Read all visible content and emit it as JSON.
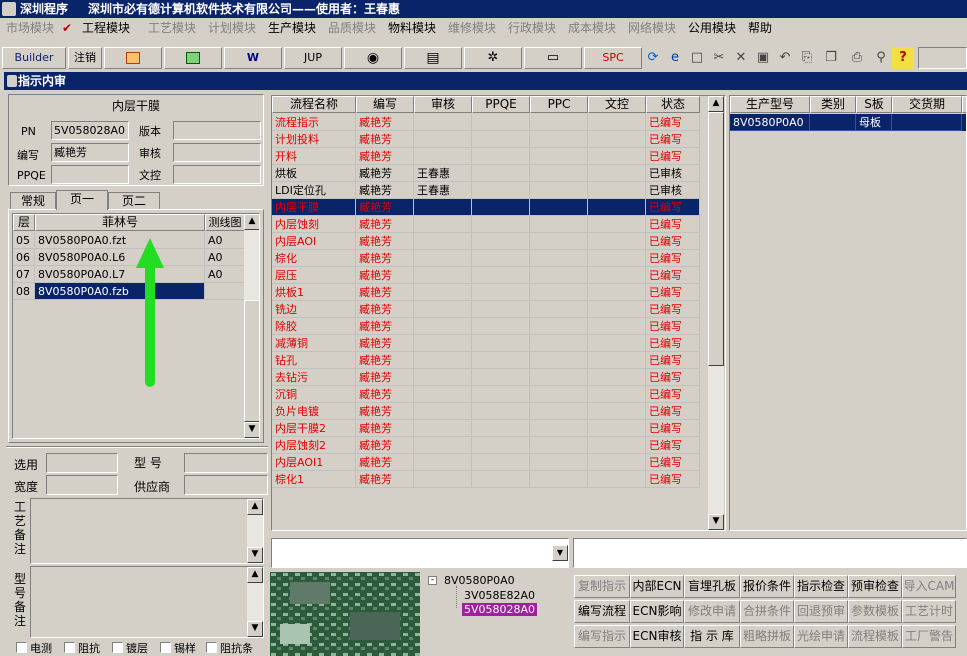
{
  "title": {
    "app": "深圳程序",
    "company": "深圳市必有德计算机软件技术有限公司——使用者：王春惠"
  },
  "menu": [
    {
      "label": "市场模块",
      "enabled": false
    },
    {
      "label": "工程模块",
      "enabled": true,
      "checked": true
    },
    {
      "label": "工艺模块",
      "enabled": false
    },
    {
      "label": "计划模块",
      "enabled": false
    },
    {
      "label": "生产模块",
      "enabled": true
    },
    {
      "label": "品质模块",
      "enabled": false
    },
    {
      "label": "物料模块",
      "enabled": true
    },
    {
      "label": "维修模块",
      "enabled": false
    },
    {
      "label": "行政模块",
      "enabled": false
    },
    {
      "label": "成本模块",
      "enabled": false
    },
    {
      "label": "网络模块",
      "enabled": false
    },
    {
      "label": "公用模块",
      "enabled": true
    },
    {
      "label": "帮助",
      "enabled": true
    }
  ],
  "toolbar": {
    "builder": "Builder",
    "cancel": "注销",
    "jup": "JUP",
    "spc": "SPC"
  },
  "panel_title": "指示内审",
  "left": {
    "section_title": "内层干膜",
    "pn_label": "PN",
    "pn_value": "5V058028A0",
    "version_label": "版本",
    "version_value": "",
    "author_label": "编写",
    "author_value": "臧艳芳",
    "review_label": "审核",
    "review_value": "",
    "ppqe_label": "PPQE",
    "ppqe_value": "",
    "doc_label": "文控",
    "doc_value": "",
    "tabs": [
      "常规",
      "页一",
      "页二"
    ],
    "film_cols": [
      "层",
      "菲林号",
      "测线图"
    ],
    "film_rows": [
      [
        "05",
        "8V0580P0A0.fzt",
        "A0"
      ],
      [
        "06",
        "8V0580P0A0.L6",
        "A0"
      ],
      [
        "07",
        "8V0580P0A0.L7",
        "A0"
      ],
      [
        "08",
        "8V0580P0A0.fzb",
        ""
      ]
    ],
    "select_label": "选用",
    "model_label": "型  号",
    "width_label": "宽度",
    "supplier_label": "供应商",
    "process_note": "工艺备注",
    "model_note": "型号备注",
    "checks": [
      "电测",
      "阻抗",
      "镀层",
      "锡样",
      "阻抗条"
    ]
  },
  "flow": {
    "cols": [
      "流程名称",
      "编写",
      "审核",
      "PPQE",
      "PPC",
      "文控",
      "状态"
    ],
    "rows": [
      {
        "name": "流程指示",
        "author": "臧艳芳",
        "review": "",
        "status": "已编写",
        "red": true
      },
      {
        "name": "计划投料",
        "author": "臧艳芳",
        "review": "",
        "status": "已编写",
        "red": true
      },
      {
        "name": "开料",
        "author": "臧艳芳",
        "review": "",
        "status": "已编写",
        "red": true
      },
      {
        "name": "烘板",
        "author": "臧艳芳",
        "review": "王春惠",
        "status": "已审核",
        "red": false
      },
      {
        "name": "LDI定位孔",
        "author": "臧艳芳",
        "review": "王春惠",
        "status": "已审核",
        "red": false
      },
      {
        "name": "内层干膜",
        "author": "臧艳芳",
        "review": "",
        "status": "已编写",
        "red": true,
        "selected": true
      },
      {
        "name": "内层蚀刻",
        "author": "臧艳芳",
        "review": "",
        "status": "已编写",
        "red": true
      },
      {
        "name": "内层AOI",
        "author": "臧艳芳",
        "review": "",
        "status": "已编写",
        "red": true
      },
      {
        "name": "棕化",
        "author": "臧艳芳",
        "review": "",
        "status": "已编写",
        "red": true
      },
      {
        "name": "层压",
        "author": "臧艳芳",
        "review": "",
        "status": "已编写",
        "red": true
      },
      {
        "name": "烘板1",
        "author": "臧艳芳",
        "review": "",
        "status": "已编写",
        "red": true
      },
      {
        "name": "铣边",
        "author": "臧艳芳",
        "review": "",
        "status": "已编写",
        "red": true
      },
      {
        "name": "除胶",
        "author": "臧艳芳",
        "review": "",
        "status": "已编写",
        "red": true
      },
      {
        "name": "减薄铜",
        "author": "臧艳芳",
        "review": "",
        "status": "已编写",
        "red": true
      },
      {
        "name": "钻孔",
        "author": "臧艳芳",
        "review": "",
        "status": "已编写",
        "red": true
      },
      {
        "name": "去钻污",
        "author": "臧艳芳",
        "review": "",
        "status": "已编写",
        "red": true
      },
      {
        "name": "沉铜",
        "author": "臧艳芳",
        "review": "",
        "status": "已编写",
        "red": true
      },
      {
        "name": "负片电镀",
        "author": "臧艳芳",
        "review": "",
        "status": "已编写",
        "red": true
      },
      {
        "name": "内层干膜2",
        "author": "臧艳芳",
        "review": "",
        "status": "已编写",
        "red": true
      },
      {
        "name": "内层蚀刻2",
        "author": "臧艳芳",
        "review": "",
        "status": "已编写",
        "red": true
      },
      {
        "name": "内层AOI1",
        "author": "臧艳芳",
        "review": "",
        "status": "已编写",
        "red": true
      },
      {
        "name": "棕化1",
        "author": "臧艳芳",
        "review": "",
        "status": "已编写",
        "red": true
      }
    ]
  },
  "prod": {
    "cols": [
      "生产型号",
      "类别",
      "S板",
      "交货期"
    ],
    "rows": [
      [
        "8V0580P0A0",
        "",
        "母板",
        ""
      ]
    ]
  },
  "tree": {
    "root": "8V0580P0A0",
    "children": [
      "3V058E82A0",
      "5V058028A0"
    ]
  },
  "buttons": [
    [
      {
        "label": "复制指示",
        "enabled": false
      },
      {
        "label": "内部ECN",
        "enabled": true
      },
      {
        "label": "盲埋孔板",
        "enabled": true
      },
      {
        "label": "报价条件",
        "enabled": true
      },
      {
        "label": "指示检查",
        "enabled": true
      },
      {
        "label": "预审检查",
        "enabled": true
      },
      {
        "label": "导入CAM",
        "enabled": false
      }
    ],
    [
      {
        "label": "编写流程",
        "enabled": true
      },
      {
        "label": "ECN影响",
        "enabled": true
      },
      {
        "label": "修改申请",
        "enabled": false
      },
      {
        "label": "合拼条件",
        "enabled": false
      },
      {
        "label": "回退预审",
        "enabled": false
      },
      {
        "label": "参数模板",
        "enabled": false
      },
      {
        "label": "工艺计时",
        "enabled": false
      }
    ],
    [
      {
        "label": "编写指示",
        "enabled": false
      },
      {
        "label": "ECN审核",
        "enabled": true
      },
      {
        "label": "指 示 库",
        "enabled": true
      },
      {
        "label": "粗略拼板",
        "enabled": false
      },
      {
        "label": "光绘申请",
        "enabled": false
      },
      {
        "label": "流程模板",
        "enabled": false
      },
      {
        "label": "工厂警告",
        "enabled": false
      }
    ]
  ]
}
